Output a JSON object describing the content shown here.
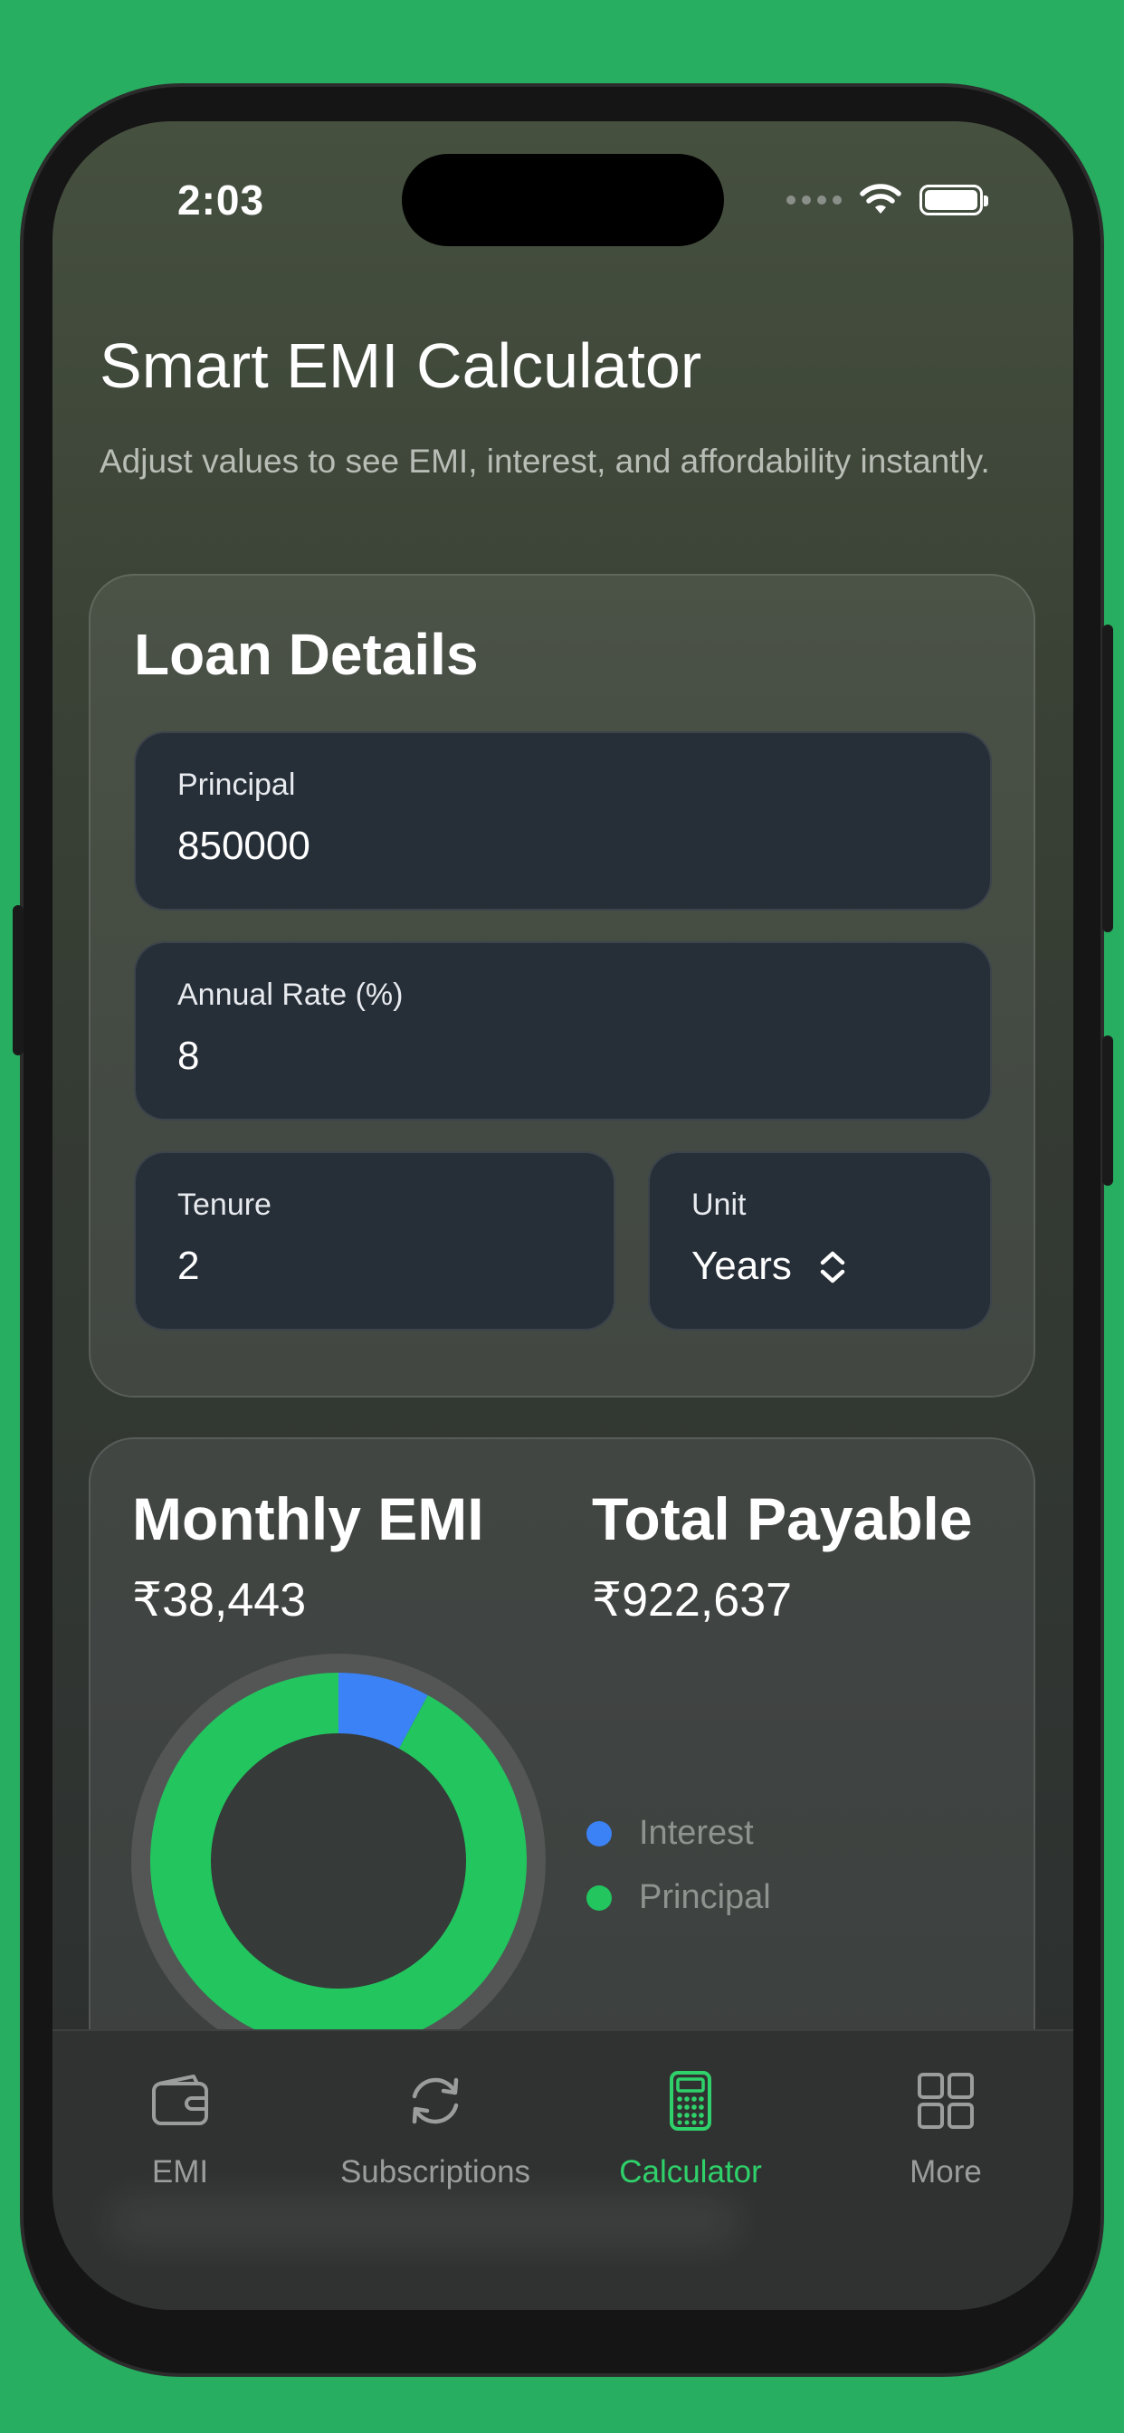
{
  "status": {
    "time": "2:03"
  },
  "header": {
    "title": "Smart EMI Calculator",
    "subtitle": "Adjust values to see EMI, interest, and affordability instantly."
  },
  "loan_details": {
    "heading": "Loan Details",
    "principal": {
      "label": "Principal",
      "value": "850000"
    },
    "rate": {
      "label": "Annual Rate (%)",
      "value": "8"
    },
    "tenure": {
      "label": "Tenure",
      "value": "2"
    },
    "unit": {
      "label": "Unit",
      "value": "Years"
    }
  },
  "summary": {
    "emi_label": "Monthly EMI",
    "emi_value": "₹38,443",
    "total_label": "Total Payable",
    "total_value": "₹922,637",
    "legend": [
      {
        "label": "Interest",
        "color": "#3b82f6"
      },
      {
        "label": "Principal",
        "color": "#22c55e"
      }
    ]
  },
  "chart_data": {
    "type": "pie",
    "series": [
      {
        "name": "Interest",
        "value": 72637,
        "color": "#3b82f6"
      },
      {
        "name": "Principal",
        "value": 850000,
        "color": "#22c55e"
      }
    ]
  },
  "tabbar": {
    "items": [
      {
        "label": "EMI",
        "icon": "wallet-icon",
        "active": false
      },
      {
        "label": "Subscriptions",
        "icon": "refresh-icon",
        "active": false
      },
      {
        "label": "Calculator",
        "icon": "calculator-icon",
        "active": true
      },
      {
        "label": "More",
        "icon": "grid-icon",
        "active": false
      }
    ],
    "active_color": "#2fd16a",
    "inactive_color": "#9a9d9b"
  }
}
